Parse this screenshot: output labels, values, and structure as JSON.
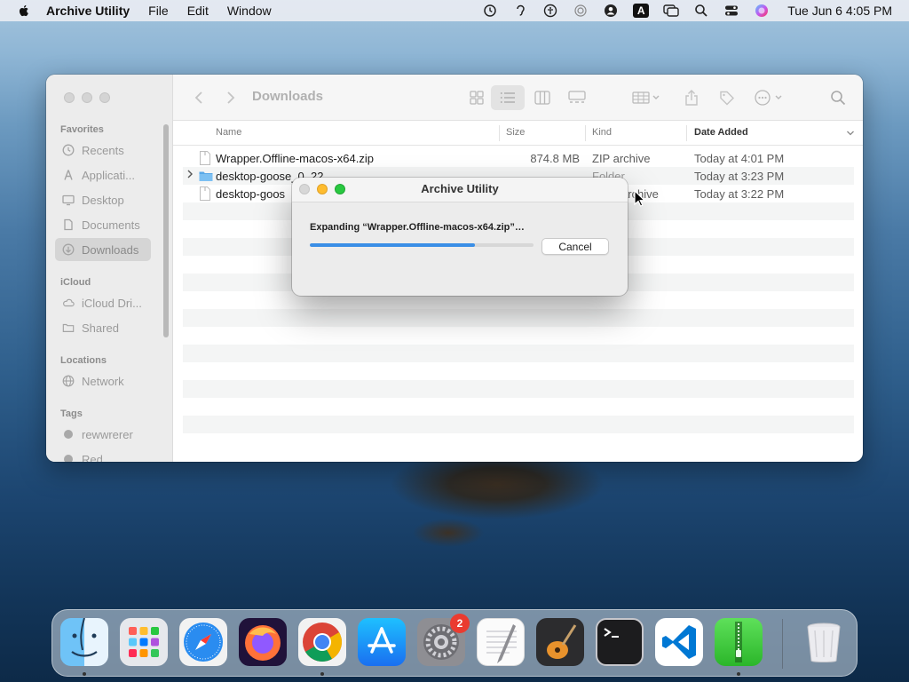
{
  "menubar": {
    "app_name": "Archive Utility",
    "menus": [
      "File",
      "Edit",
      "Window"
    ],
    "input_badge": "A",
    "clock": "Tue Jun 6  4:05 PM"
  },
  "finder": {
    "title": "Downloads",
    "sidebar": {
      "favorites_label": "Favorites",
      "favorites": [
        {
          "label": "Recents",
          "icon": "clock-icon"
        },
        {
          "label": "Applicati...",
          "icon": "applications-icon"
        },
        {
          "label": "Desktop",
          "icon": "desktop-icon"
        },
        {
          "label": "Documents",
          "icon": "document-icon"
        },
        {
          "label": "Downloads",
          "icon": "download-icon"
        }
      ],
      "icloud_label": "iCloud",
      "icloud": [
        {
          "label": "iCloud Dri...",
          "icon": "cloud-icon"
        },
        {
          "label": "Shared",
          "icon": "shared-folder-icon"
        }
      ],
      "locations_label": "Locations",
      "locations": [
        {
          "label": "Network",
          "icon": "network-globe-icon"
        }
      ],
      "tags_label": "Tags",
      "tags": [
        {
          "label": "rewwrerer"
        },
        {
          "label": "Red"
        }
      ]
    },
    "columns": {
      "name": "Name",
      "size": "Size",
      "kind": "Kind",
      "date_added": "Date Added"
    },
    "files": [
      {
        "name": "Wrapper.Offline-macos-x64.zip",
        "size": "874.8 MB",
        "kind": "ZIP archive",
        "date": "Today at 4:01 PM",
        "icon": "zip-file-icon"
      },
      {
        "name": "desktop-goose_0_22",
        "size": "",
        "kind": "Folder",
        "date": "Today at 3:23 PM",
        "icon": "folder-icon"
      },
      {
        "name": "desktop-goos",
        "size": "",
        "kind": "archive",
        "date": "Today at 3:22 PM",
        "icon": "zip-file-icon"
      }
    ]
  },
  "dialog": {
    "title": "Archive Utility",
    "message": "Expanding “Wrapper.Offline-macos-x64.zip”…",
    "cancel_label": "Cancel",
    "progress": 0.74
  },
  "dock": {
    "items": [
      {
        "name": "Finder",
        "icon": "finder-icon",
        "running": true
      },
      {
        "name": "Launchpad",
        "icon": "launchpad-icon",
        "running": false
      },
      {
        "name": "Safari",
        "icon": "safari-icon",
        "running": false
      },
      {
        "name": "Firefox",
        "icon": "firefox-icon",
        "running": false
      },
      {
        "name": "Chrome",
        "icon": "chrome-icon",
        "running": true
      },
      {
        "name": "App Store",
        "icon": "app-store-icon",
        "running": false
      },
      {
        "name": "System Settings",
        "icon": "system-settings-icon",
        "running": false,
        "badge": "2"
      },
      {
        "name": "TextEdit",
        "icon": "textedit-icon",
        "running": false
      },
      {
        "name": "GarageBand",
        "icon": "garageband-icon",
        "running": false
      },
      {
        "name": "Terminal",
        "icon": "terminal-icon",
        "running": false
      },
      {
        "name": "VS Code",
        "icon": "vscode-icon",
        "running": false
      },
      {
        "name": "Archive Utility",
        "icon": "archive-utility-icon",
        "running": true
      },
      {
        "name": "Trash",
        "icon": "trash-icon",
        "running": false
      }
    ]
  },
  "colors": {
    "accent_blue": "#3a8ee6",
    "close_red": "#ff5f57",
    "minimize_yellow": "#febc2e",
    "zoom_green": "#28c840",
    "badge_red": "#ea3b30"
  }
}
